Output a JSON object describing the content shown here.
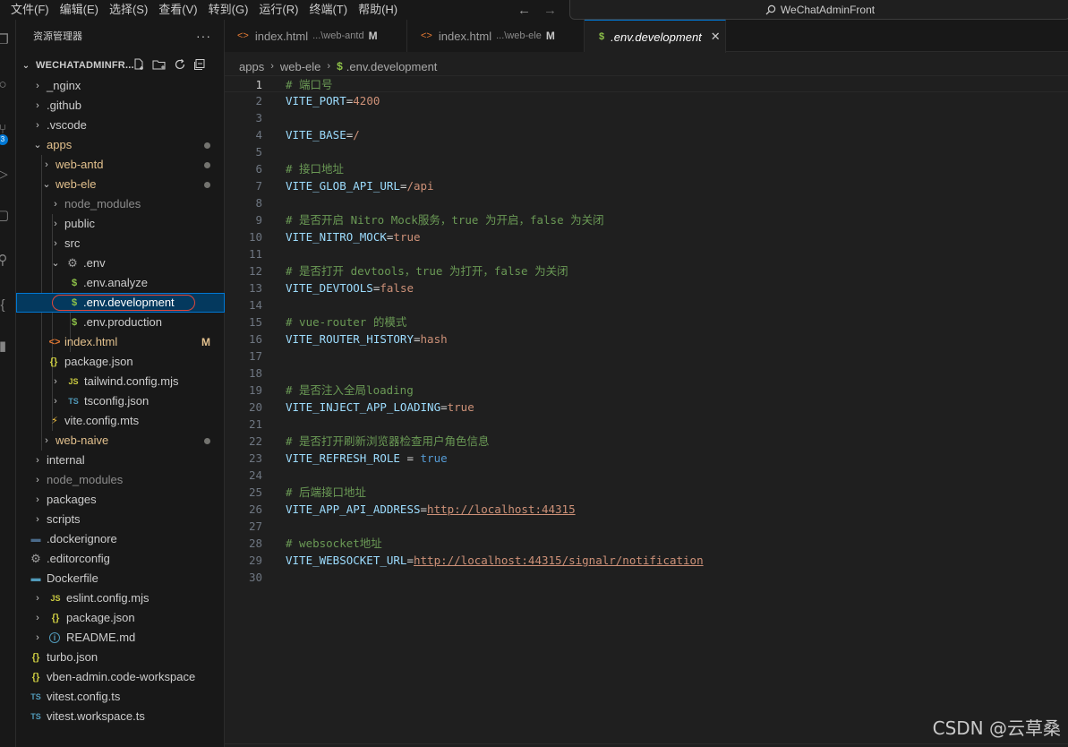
{
  "menubar": {
    "items": [
      "文件(F)",
      "编辑(E)",
      "选择(S)",
      "查看(V)",
      "转到(G)",
      "运行(R)",
      "终端(T)",
      "帮助(H)"
    ]
  },
  "command_center": {
    "label": "WeChatAdminFront"
  },
  "activity_bar": {
    "scm_badge": "3"
  },
  "explorer": {
    "title": "资源管理器",
    "more": "···",
    "root_label": "WECHATADMINFR...",
    "tree": [
      {
        "label": "_nginx",
        "type": "folder"
      },
      {
        "label": ".github",
        "type": "folder"
      },
      {
        "label": ".vscode",
        "type": "folder"
      },
      {
        "label": "apps",
        "type": "folder-open"
      },
      {
        "label": "web-antd",
        "type": "folder"
      },
      {
        "label": "web-ele",
        "type": "folder-open"
      },
      {
        "label": "node_modules",
        "type": "folder"
      },
      {
        "label": "public",
        "type": "folder"
      },
      {
        "label": "src",
        "type": "folder"
      },
      {
        "label": ".env",
        "type": "folder-open"
      },
      {
        "label": ".env.analyze",
        "type": "file"
      },
      {
        "label": ".env.development",
        "type": "file"
      },
      {
        "label": ".env.production",
        "type": "file"
      },
      {
        "label": "index.html",
        "type": "file",
        "status": "M"
      },
      {
        "label": "package.json",
        "type": "file"
      },
      {
        "label": "tailwind.config.mjs",
        "type": "folder"
      },
      {
        "label": "tsconfig.json",
        "type": "folder"
      },
      {
        "label": "vite.config.mts",
        "type": "file"
      },
      {
        "label": "web-naive",
        "type": "folder"
      },
      {
        "label": "internal",
        "type": "folder"
      },
      {
        "label": "node_modules",
        "type": "folder"
      },
      {
        "label": "packages",
        "type": "folder"
      },
      {
        "label": "scripts",
        "type": "folder"
      },
      {
        "label": ".dockerignore",
        "type": "file"
      },
      {
        "label": ".editorconfig",
        "type": "file"
      },
      {
        "label": "Dockerfile",
        "type": "file"
      },
      {
        "label": "eslint.config.mjs",
        "type": "folder"
      },
      {
        "label": "package.json",
        "type": "folder"
      },
      {
        "label": "README.md",
        "type": "folder"
      },
      {
        "label": "turbo.json",
        "type": "file"
      },
      {
        "label": "vben-admin.code-workspace",
        "type": "file"
      },
      {
        "label": "vitest.config.ts",
        "type": "file"
      },
      {
        "label": "vitest.workspace.ts",
        "type": "file"
      }
    ],
    "icon_glyphs": {
      "dollar": "$",
      "braces": "{}",
      "js": "JS",
      "ts": "TS",
      "html": "<>",
      "info": "i"
    }
  },
  "tabs": [
    {
      "name": "index.html",
      "desc": "...\\web-antd",
      "status": "M"
    },
    {
      "name": "index.html",
      "desc": "...\\web-ele",
      "status": "M"
    },
    {
      "name": ".env.development",
      "close": "✕"
    }
  ],
  "breadcrumb": [
    "apps",
    "web-ele",
    ".env.development"
  ],
  "code_lines": [
    {
      "n": "1",
      "comment": "# 端口号"
    },
    {
      "n": "2",
      "key": "VITE_PORT",
      "eq": "=",
      "value": "4200",
      "kind": "val"
    },
    {
      "n": "3"
    },
    {
      "n": "4",
      "key": "VITE_BASE",
      "eq": "=",
      "value": "/",
      "kind": "val"
    },
    {
      "n": "5"
    },
    {
      "n": "6",
      "comment": "# 接口地址"
    },
    {
      "n": "7",
      "key": "VITE_GLOB_API_URL",
      "eq": "=",
      "value": "/api",
      "kind": "val"
    },
    {
      "n": "8"
    },
    {
      "n": "9",
      "comment": "# 是否开启 Nitro Mock服务，true 为开启，false 为关闭"
    },
    {
      "n": "10",
      "key": "VITE_NITRO_MOCK",
      "eq": "=",
      "value": "true",
      "kind": "val"
    },
    {
      "n": "11"
    },
    {
      "n": "12",
      "comment": "# 是否打开 devtools，true 为打开，false 为关闭"
    },
    {
      "n": "13",
      "key": "VITE_DEVTOOLS",
      "eq": "=",
      "value": "false",
      "kind": "val"
    },
    {
      "n": "14"
    },
    {
      "n": "15",
      "comment": "# vue-router 的模式"
    },
    {
      "n": "16",
      "key": "VITE_ROUTER_HISTORY",
      "eq": "=",
      "value": "hash",
      "kind": "val"
    },
    {
      "n": "17"
    },
    {
      "n": "18"
    },
    {
      "n": "19",
      "comment": "# 是否注入全局loading"
    },
    {
      "n": "20",
      "key": "VITE_INJECT_APP_LOADING",
      "eq": "=",
      "value": "true",
      "kind": "val"
    },
    {
      "n": "21"
    },
    {
      "n": "22",
      "comment": "# 是否打开刷新浏览器检查用户角色信息"
    },
    {
      "n": "23",
      "key": "VITE_REFRESH_ROLE",
      "eq": " = ",
      "value": "true",
      "kind": "bool"
    },
    {
      "n": "24"
    },
    {
      "n": "25",
      "comment": "# 后端接口地址"
    },
    {
      "n": "26",
      "key": "VITE_APP_API_ADDRESS",
      "eq": "=",
      "value": "http://localhost:44315",
      "kind": "url"
    },
    {
      "n": "27"
    },
    {
      "n": "28",
      "comment": "# websocket地址"
    },
    {
      "n": "29",
      "key": "VITE_WEBSOCKET_URL",
      "eq": "=",
      "value": "http://localhost:44315/signalr/notification",
      "kind": "url"
    },
    {
      "n": "30"
    }
  ],
  "watermark": "CSDN @云草桑",
  "colors": {
    "accent": "#0078d4",
    "selection_ring": "#e0473a",
    "env_icon": "#8dc149",
    "html_icon": "#e37933",
    "json_icon": "#cbcb41",
    "ts_icon": "#519aba",
    "comment": "#6a9955",
    "key": "#9cdcfe",
    "string": "#ce9178",
    "bool": "#569cd6"
  }
}
